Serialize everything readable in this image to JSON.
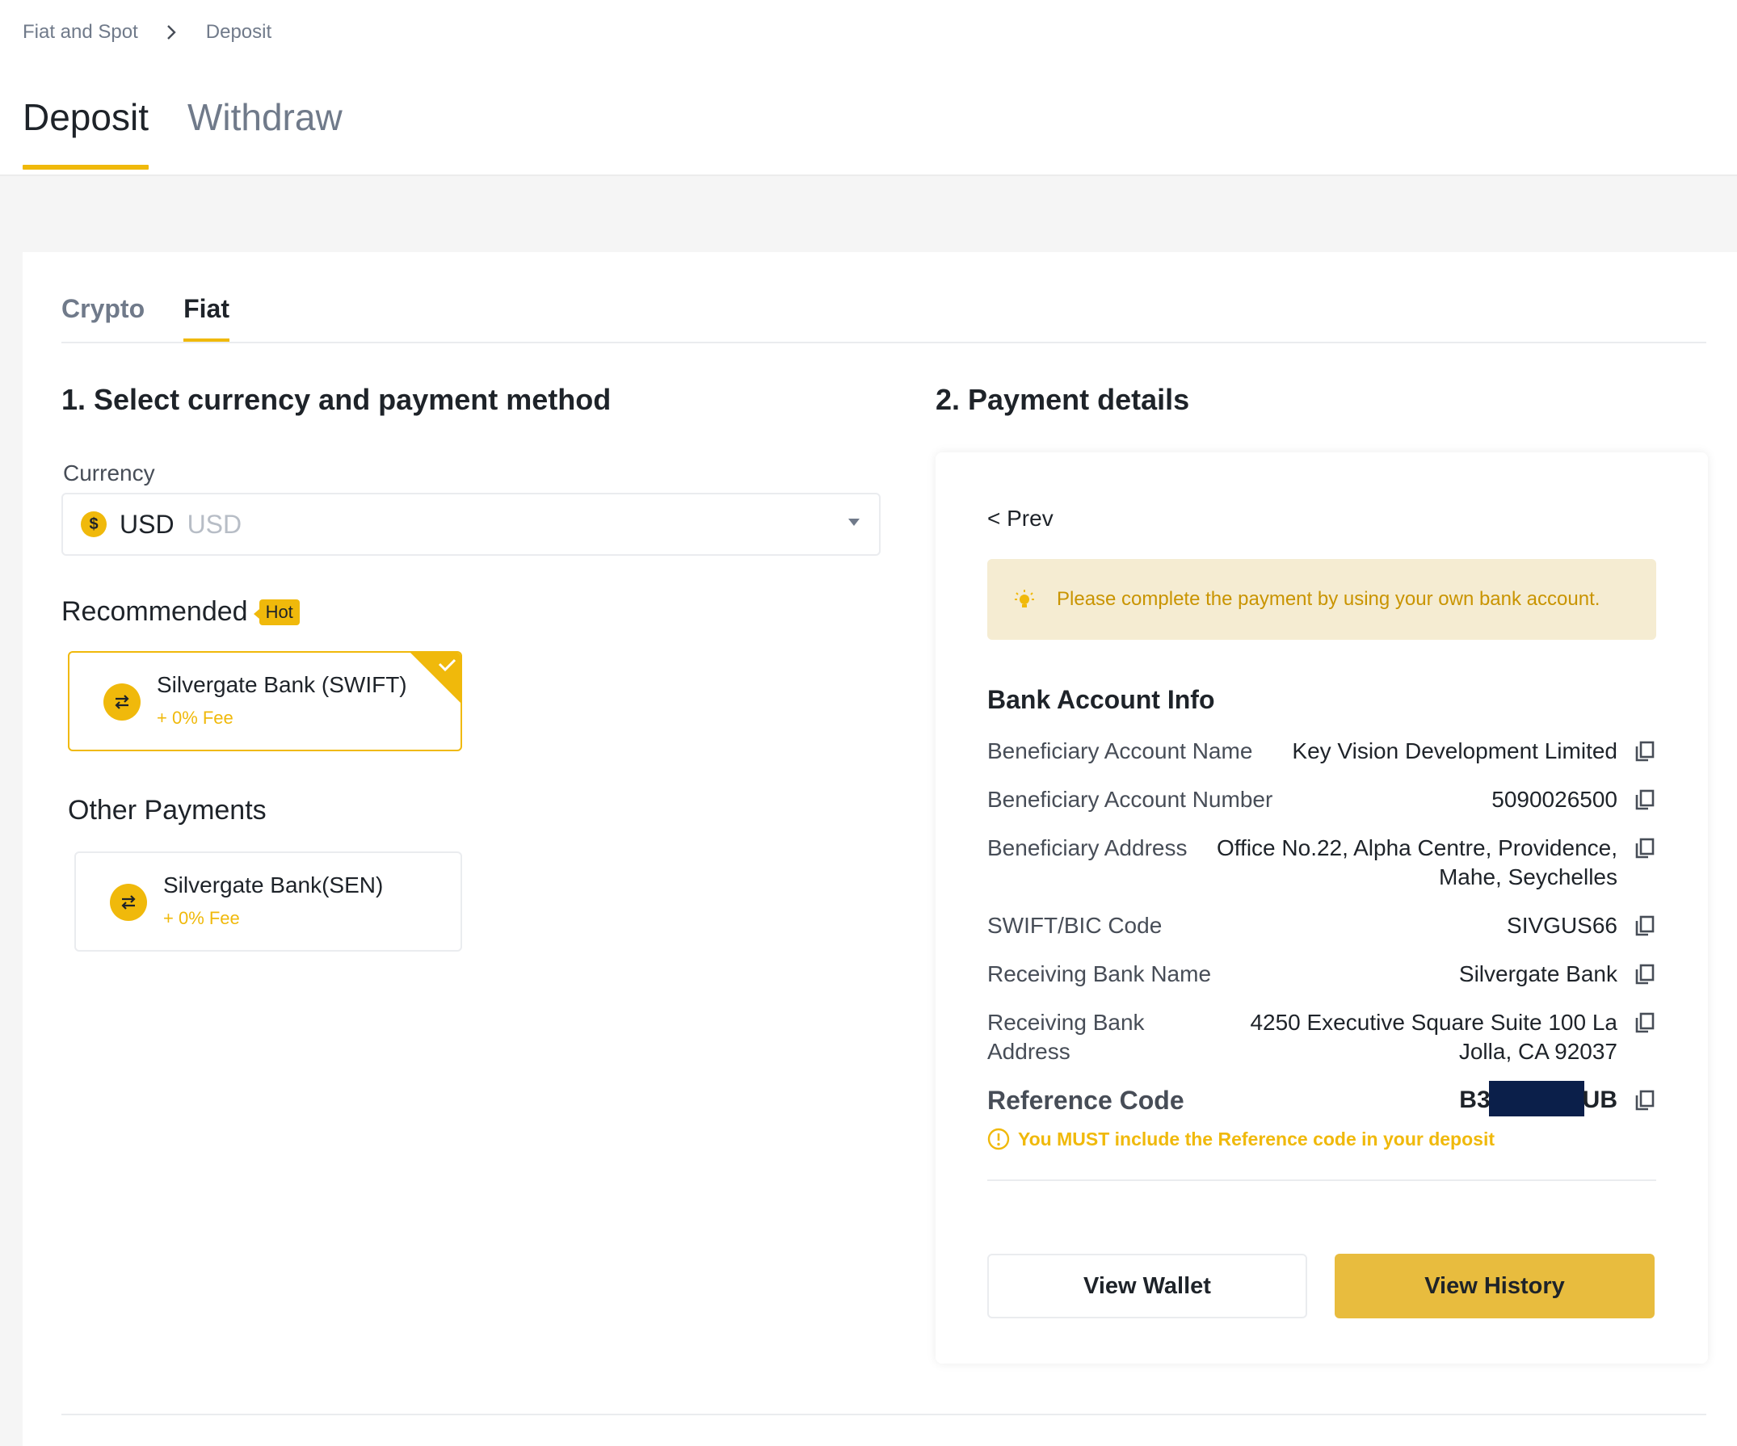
{
  "breadcrumb": {
    "items": [
      "Fiat and Spot",
      "Deposit"
    ]
  },
  "page_tabs": [
    {
      "label": "Deposit",
      "active": true
    },
    {
      "label": "Withdraw",
      "active": false
    }
  ],
  "sub_tabs": [
    {
      "label": "Crypto",
      "active": false
    },
    {
      "label": "Fiat",
      "active": true
    }
  ],
  "left": {
    "section_title": "1. Select currency and payment method",
    "currency_label": "Currency",
    "currency": {
      "code": "USD",
      "name": "USD",
      "coin_symbol": "$"
    },
    "recommended_label": "Recommended",
    "hot_badge": "Hot",
    "recommended_method": {
      "name": "Silvergate Bank (SWIFT)",
      "fee": "+ 0% Fee",
      "selected": true
    },
    "other_label": "Other Payments",
    "other_method": {
      "name": "Silvergate Bank(SEN)",
      "fee": "+ 0% Fee"
    }
  },
  "right": {
    "section_title": "2. Payment details",
    "prev": "< Prev",
    "notice": "Please complete the payment by using your own bank account.",
    "bank_info_title": "Bank Account Info",
    "rows": [
      {
        "label": "Beneficiary Account Name",
        "value": "Key Vision Development Limited"
      },
      {
        "label": "Beneficiary Account Number",
        "value": "5090026500"
      },
      {
        "label": "Beneficiary Address",
        "value_line1": "Office No.22, Alpha Centre, Providence,",
        "value_line2": "Mahe, Seychelles"
      },
      {
        "label": "SWIFT/BIC Code",
        "value": "SIVGUS66"
      },
      {
        "label": "Receiving Bank Name",
        "value": "Silvergate Bank"
      },
      {
        "label_line1": "Receiving Bank",
        "label_line2": "Address",
        "value_line1": "4250 Executive Square Suite 100 La",
        "value_line2": "Jolla, CA 92037"
      }
    ],
    "reference": {
      "label": "Reference Code",
      "prefix": "B3",
      "suffix": "UB",
      "warning": "You MUST include the Reference code in your deposit"
    },
    "buttons": {
      "view_wallet": "View Wallet",
      "view_history": "View History"
    }
  },
  "colors": {
    "accent": "#f0b90b",
    "text": "#1e2329",
    "muted": "#707a8a",
    "redaction": "#0b1f4a"
  },
  "icons": [
    "chevron-right-icon",
    "usd-coin-icon",
    "caret-down-icon",
    "transfer-icon",
    "checkmark-icon",
    "bulb-icon",
    "copy-icon",
    "warning-icon"
  ]
}
